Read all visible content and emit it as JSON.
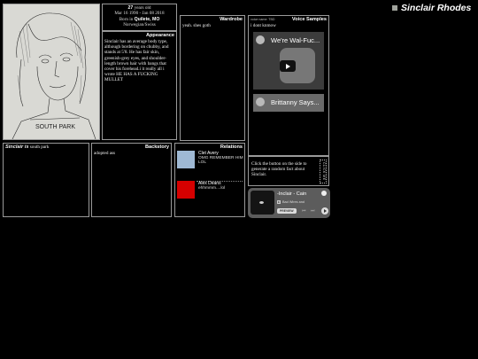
{
  "title": "Sinclair Rhodes",
  "colors": {
    "title_square": "#a0a39c",
    "relation_1": "#9fb9d4",
    "relation_2": "#d60000"
  },
  "portrait": {
    "tag": "",
    "sketch_text": "SOUTH PARK"
  },
  "stats": {
    "age_num": "27",
    "age_suffix": " years old",
    "dates": "Mar 16 1990 - Jan 08 2018",
    "born_prefix": "Born in ",
    "birthplace": "Quilete, MO",
    "ethnicity": "Norwegian/Swiss"
  },
  "appearance": {
    "heading": "Appearance",
    "text": "Sinclair has an average body type, although bordering on chubby, and stands at 5'8. He has fair skin, greenish-grey eyes, and shoulder-length brown hair with bangs that cover his forehead.i it really all i wrote HE HAS A FUCKING MULLET"
  },
  "wardrobe": {
    "heading": "Wardrobe",
    "text": "yeah. shes goth"
  },
  "voice": {
    "heading": "Voice Samples",
    "voice_name": "voice name: TBD",
    "text": "i dont knmow",
    "video1_title": "We're Wal-Fuc...",
    "video2_title": "Brittanny Says..."
  },
  "fact": {
    "text": "Click the button on the side to generate a random fact about Sinclair.",
    "button_label": "CLICK ME"
  },
  "player": {
    "song": "-Inclair - Cain",
    "explicit": "E",
    "artist": "Bad Wires and",
    "preview": "PREVIEW",
    "prev_icon": "⏮",
    "next_icon": "⏭"
  },
  "current": {
    "name": "Sinclair is",
    "text": " south park"
  },
  "backstory": {
    "heading": "Backstory",
    "text": "adopted ass"
  },
  "relations": {
    "heading": "Relations",
    "items": [
      {
        "name": "Clet Avery",
        "note": "OMG REMEMBER HIM LOL"
      },
      {
        "name": "Alex Deans",
        "note": "ehhmmm....lol"
      }
    ]
  }
}
